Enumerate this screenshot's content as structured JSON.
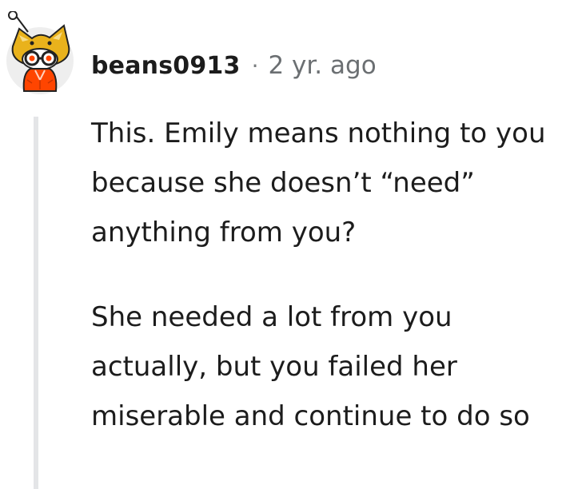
{
  "comment": {
    "username": "beans0913",
    "separator": "·",
    "timestamp": "2 yr. ago",
    "avatar_icon": "snoo-avatar-icon",
    "paragraph_1": "This. Emily means nothing to you because she doesn’t “need” anything from you?",
    "paragraph_2": "She needed a lot from you actually, but you failed her miserable and continue to do so"
  },
  "colors": {
    "text": "#1c1c1c",
    "meta": "#6b6f72",
    "thread_line": "#e4e5e7",
    "avatar_accent": "#e9b21c"
  }
}
